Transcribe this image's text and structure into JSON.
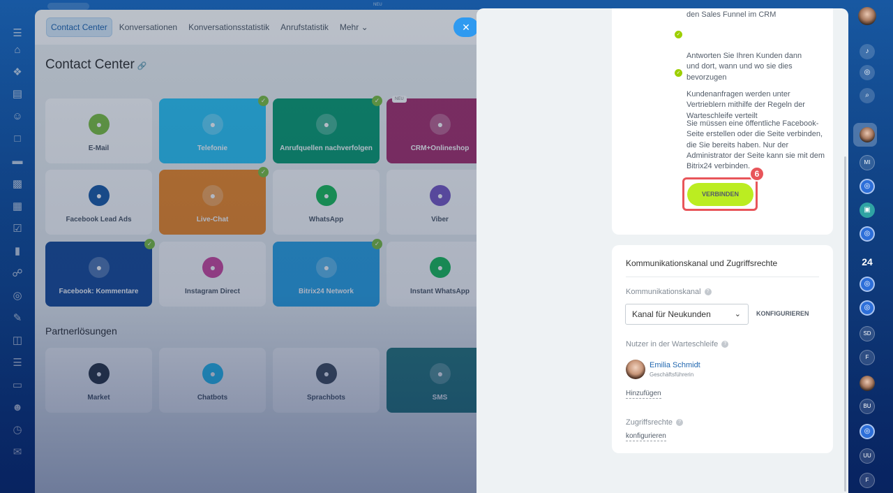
{
  "top_strip": {
    "tag": "NEU"
  },
  "left_rail": {
    "icons": [
      "menu-icon",
      "home-icon",
      "puzzle-icon",
      "document-icon",
      "contacts-icon",
      "file-icon",
      "card-icon",
      "calendar-icon",
      "sheet-icon",
      "checkbox-icon",
      "bar-chart-icon",
      "cart-icon",
      "target-icon",
      "pen-icon",
      "building-icon",
      "filter-icon",
      "screen-icon",
      "group-icon",
      "clock-icon",
      "chat-icon"
    ]
  },
  "tabs": [
    {
      "label": "Contact Center",
      "active": true
    },
    {
      "label": "Konversationen"
    },
    {
      "label": "Konversationsstatistik"
    },
    {
      "label": "Anrufstatistik"
    },
    {
      "label": "Mehr"
    }
  ],
  "page_title": "Contact Center",
  "tiles": [
    {
      "label": "E-Mail",
      "icon": "mail-icon",
      "color": "#7fc144"
    },
    {
      "label": "Telefonie",
      "icon": "phone-icon",
      "color": "#2fc6f6",
      "bg": "#2fc6f6",
      "checked": true
    },
    {
      "label": "Anrufquellen nachverfolgen",
      "icon": "call-track-icon",
      "color": "#1fab83",
      "bg": "#0e9e74",
      "checked": true
    },
    {
      "label": "CRM+Onlineshop",
      "icon": "shop-icon",
      "color": "#b84f8e",
      "bg": "#a8336f",
      "badge": "NEU"
    },
    {
      "label": "Facebook Lead Ads",
      "icon": "lead-ads-icon",
      "color": "#1f5ea8"
    },
    {
      "label": "Live-Chat",
      "icon": "chat-icon",
      "color": "#ff9a3c",
      "bg": "#f28c29",
      "checked": true
    },
    {
      "label": "WhatsApp",
      "icon": "whatsapp-icon",
      "color": "#1fbe5c"
    },
    {
      "label": "Viber",
      "icon": "viber-icon",
      "color": "#7b5cc5"
    },
    {
      "label": "Facebook: Kommentare",
      "icon": "fb-comment-icon",
      "color": "#1f5ea8",
      "bg": "#1c4f9c",
      "checked": true
    },
    {
      "label": "Instagram Direct",
      "icon": "instagram-icon",
      "color": "#d24ca0"
    },
    {
      "label": "Bitrix24 Network",
      "icon": "cloud-icon",
      "color": "#2fc6f6",
      "bg": "#2fa6e6",
      "checked": true
    },
    {
      "label": "Instant WhatsApp",
      "icon": "whatsapp-icon",
      "color": "#1fbe5c"
    }
  ],
  "section_title": "Partnerlösungen",
  "partner_tiles": [
    {
      "label": "Market",
      "icon": "market-icon",
      "color": "#333b45"
    },
    {
      "label": "Chatbots",
      "icon": "bot-icon",
      "color": "#2fc6f6"
    },
    {
      "label": "Sprachbots",
      "icon": "mic-icon",
      "color": "#4b5560"
    },
    {
      "label": "SMS",
      "icon": "box-icon",
      "color": "#3e6f8c",
      "bg": "#2e8080"
    }
  ],
  "close_icon": "close-icon",
  "slider": {
    "bullets": [
      "den Sales Funnel im CRM",
      "Antworten Sie Ihren Kunden dann\nund dort, wann und wo sie dies\nbevorzugen",
      "Kundenanfragen werden unter\nVertrieblern mithilfe der Regeln der\nWarteschleife verteilt"
    ],
    "info": "Sie müssen eine öffentliche Facebook-Seite erstellen oder die Seite verbinden, die Sie bereits haben. Nur der Administrator der Seite kann sie mit dem Bitrix24 verbinden.",
    "connect_label": "VERBINDEN",
    "step_number": "6",
    "card2": {
      "title": "Kommunikationskanal und Zugriffsrechte",
      "channel_label": "Kommunikationskanal",
      "channel_value": "Kanal für Neukunden",
      "configure_label": "KONFIGURIEREN",
      "queue_label": "Nutzer in der Warteschleife",
      "user_name": "Emilia Schmidt",
      "user_role": "Geschäftsführerin",
      "add_label": "Hinzufügen",
      "access_label": "Zugriffsrechte",
      "access_link": "konfigurieren"
    }
  },
  "right_rail": {
    "counter": "24",
    "items": [
      {
        "kind": "bell-icon"
      },
      {
        "kind": "spiral-icon"
      },
      {
        "kind": "search-chat-icon"
      },
      {
        "kind": "face"
      },
      {
        "kind": "ghost",
        "text": "MI"
      },
      {
        "kind": "blue"
      },
      {
        "kind": "teal"
      },
      {
        "kind": "blue"
      },
      {
        "kind": "blue"
      },
      {
        "kind": "blue"
      },
      {
        "kind": "ghost",
        "text": "SD"
      },
      {
        "kind": "ghost",
        "text": "F"
      },
      {
        "kind": "face"
      },
      {
        "kind": "ghost",
        "text": "BU"
      },
      {
        "kind": "blue"
      },
      {
        "kind": "ghost",
        "text": "UU"
      },
      {
        "kind": "ghost",
        "text": "F"
      }
    ]
  }
}
